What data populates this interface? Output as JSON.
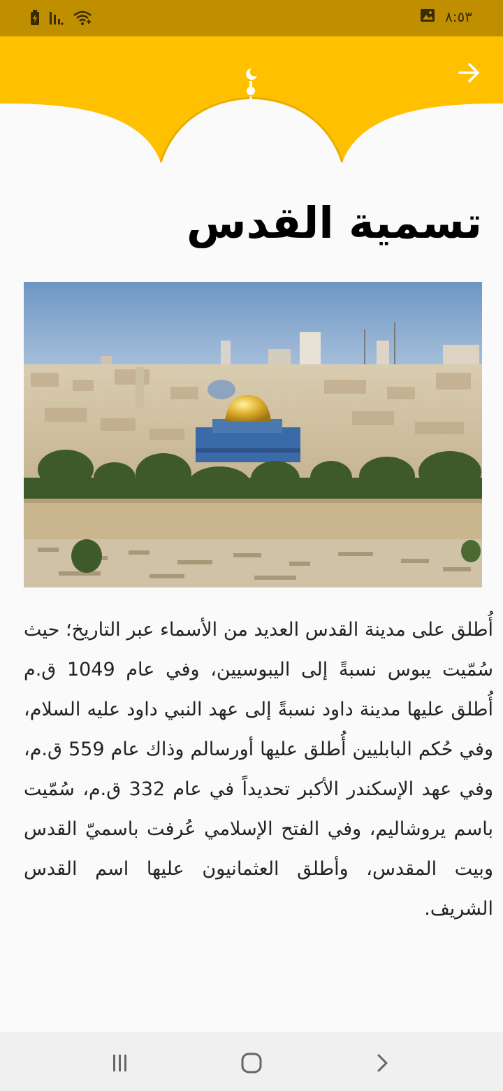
{
  "status_bar": {
    "time": "٨:٥٣",
    "icons": [
      "battery-charging-icon",
      "signal-icon",
      "wifi-icon",
      "image-notification-icon"
    ]
  },
  "header": {
    "back_icon": "arrow-right-icon",
    "ornament_icon": "crescent-dome-finial-icon",
    "colors": {
      "header": "#ffc000",
      "status_bar": "#bf8f00"
    }
  },
  "article": {
    "title": "تسمية القدس",
    "image_alt": "jerusalem-panorama",
    "body": "أُطلق على مدينة القدس العديد من الأسماء عبر التاريخ؛ حيث سُمّيت يبوس نسبةً إلى اليبوسيين، وفي عام 1049 ق.م أُطلق عليها مدينة داود نسبةً إلى عهد النبي داود عليه السلام، وفي حُكم البابليين أُطلق عليها أورسالم وذاك عام 559 ق.م، وفي عهد الإسكندر الأكبر تحديداً في عام 332 ق.م، سُمّيت باسم يروشاليم، وفي الفتح الإسلامي عُرفت باسميّ القدس وبيت المقدس، وأطلق العثمانيون عليها اسم القدس الشريف."
  },
  "nav_bar": {
    "buttons": [
      "recents-icon",
      "home-icon",
      "back-icon"
    ]
  }
}
